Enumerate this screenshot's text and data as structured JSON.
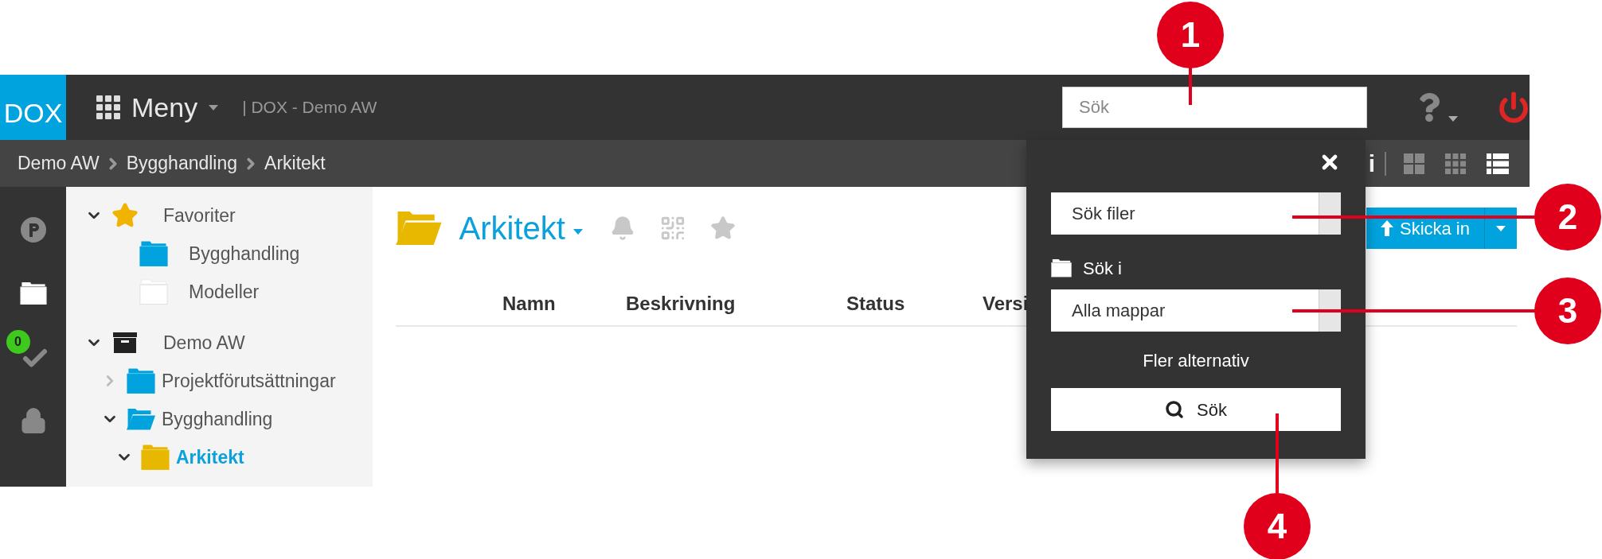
{
  "header": {
    "logo": "DOX",
    "menu": "Meny",
    "context": "| DOX - Demo AW",
    "search": {
      "placeholder": "Sök"
    }
  },
  "breadcrumb": [
    "Demo AW",
    "Bygghandling",
    "Arkitekt"
  ],
  "toolbar": {
    "info": "i",
    "views": [
      {
        "kind": "large",
        "selected": false
      },
      {
        "kind": "small",
        "selected": false
      },
      {
        "kind": "list",
        "selected": true
      }
    ]
  },
  "rail": [
    {
      "kind": "parking",
      "selected": false
    },
    {
      "kind": "folder",
      "selected": true
    },
    {
      "kind": "tasks",
      "selected": false,
      "badge": "0"
    },
    {
      "kind": "lock",
      "selected": false
    }
  ],
  "tree": [
    {
      "kind": "favorites",
      "label": "Favoriter",
      "expanded": true,
      "selected": false,
      "children": [
        {
          "label": "Bygghandling",
          "color": "#00a3de",
          "selected": false
        },
        {
          "label": "Modeller",
          "color": "#ffffff",
          "selected": false
        }
      ]
    },
    {
      "kind": "archive",
      "label": "Demo AW",
      "expanded": true,
      "selected": false,
      "children": [
        {
          "label": "Projektförutsättningar",
          "color": "#00a3de",
          "expanded": false,
          "selected": false
        },
        {
          "label": "Bygghandling",
          "color": "#00a3de",
          "expanded": true,
          "selected": false,
          "children": [
            {
              "label": "Arkitekt",
              "color": "#e8b800",
              "expanded": true,
              "selected": true
            }
          ]
        }
      ]
    }
  ],
  "folder": {
    "title": "Arkitekt",
    "columns": [
      "Namn",
      "Beskrivning",
      "Status",
      "Versi"
    ],
    "upload_button": "Skicka in"
  },
  "search_popup": {
    "type_select": "Sök filer",
    "scope_label": "Sök i",
    "scope_select": "Alla mappar",
    "more": "Fler alternativ",
    "search_button": "Sök"
  },
  "callouts": [
    "1",
    "2",
    "3",
    "4"
  ]
}
